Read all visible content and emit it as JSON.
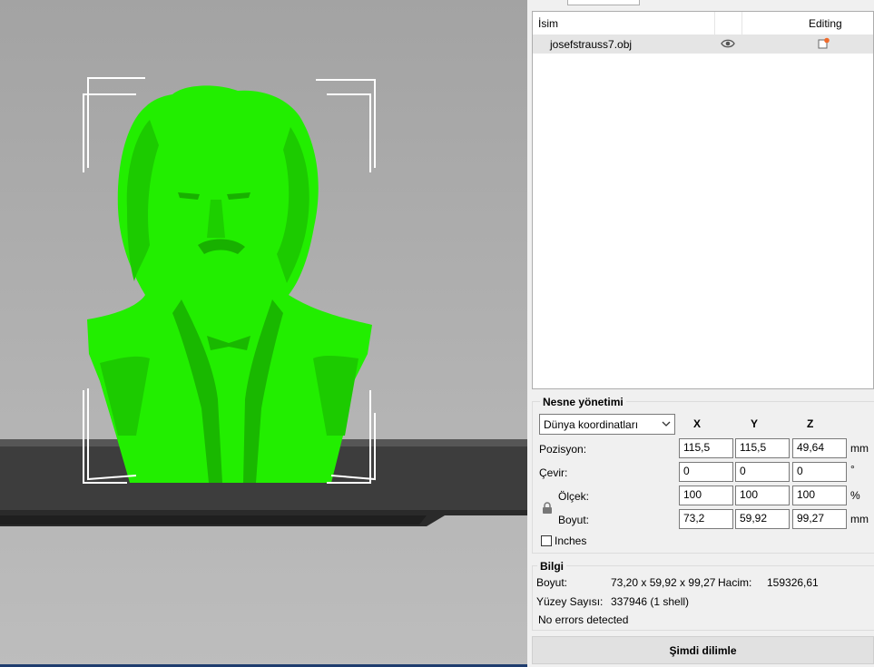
{
  "object_list": {
    "header_name": "İsim",
    "header_editing": "Editing",
    "items": [
      {
        "name": "josefstrauss7.obj",
        "visibility_icon": "eye-icon",
        "edit_icon": "edit-object-icon"
      }
    ]
  },
  "manipulation": {
    "title": "Nesne yönetimi",
    "coordinate_system": "Dünya koordinatları",
    "axes": [
      "X",
      "Y",
      "Z"
    ],
    "position": {
      "label": "Pozisyon:",
      "x": "115,5",
      "y": "115,5",
      "z": "49,64",
      "unit": "mm"
    },
    "rotation": {
      "label": "Çevir:",
      "x": "0",
      "y": "0",
      "z": "0",
      "unit": "°"
    },
    "scale": {
      "label": "Ölçek:",
      "x": "100",
      "y": "100",
      "z": "100",
      "unit": "%"
    },
    "size": {
      "label": "Boyut:",
      "x": "73,2",
      "y": "59,92",
      "z": "99,27",
      "unit": "mm"
    },
    "inches_label": "Inches",
    "inches_checked": false
  },
  "info": {
    "title": "Bilgi",
    "size_label": "Boyut:",
    "size_value": "73,20 x 59,92 x 99,27",
    "volume_label": "Hacim:",
    "volume_value": "159326,61",
    "facets_label": "Yüzey Sayısı:",
    "facets_value": "337946 (1 shell)",
    "status": "No errors detected"
  },
  "slice_button": "Şimdi dilimle",
  "colors": {
    "model": "#22ee00",
    "selection_bracket": "#ffffff",
    "bed": "#3a3a3a"
  }
}
